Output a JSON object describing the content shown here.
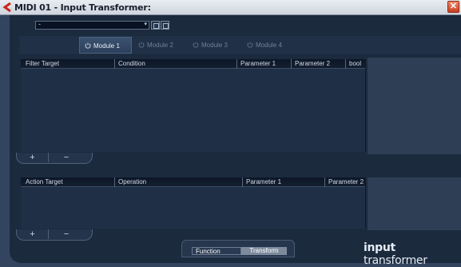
{
  "window": {
    "title": "MIDI 01 - Input Transformer:",
    "close_glyph": "✕"
  },
  "preset": {
    "value": "-",
    "arrow": "▾"
  },
  "modules": [
    {
      "label": "Module 1",
      "active": true
    },
    {
      "label": "Module 2",
      "active": false
    },
    {
      "label": "Module 3",
      "active": false
    },
    {
      "label": "Module 4",
      "active": false
    }
  ],
  "filter_table": {
    "columns": [
      "Filter Target",
      "Condition",
      "Parameter 1",
      "Parameter 2",
      "bool"
    ],
    "rows": []
  },
  "action_table": {
    "columns": [
      "Action Target",
      "Operation",
      "Parameter 1",
      "Parameter 2"
    ],
    "rows": []
  },
  "row_controls": {
    "add": "+",
    "remove": "−"
  },
  "function": {
    "label": "Function",
    "value": "Transform"
  },
  "logo": {
    "bold": "input",
    "light": " transformer"
  },
  "colors": {
    "background": "#1b2a3d",
    "header": "#0c1627",
    "accent": "#7d8a9c"
  }
}
